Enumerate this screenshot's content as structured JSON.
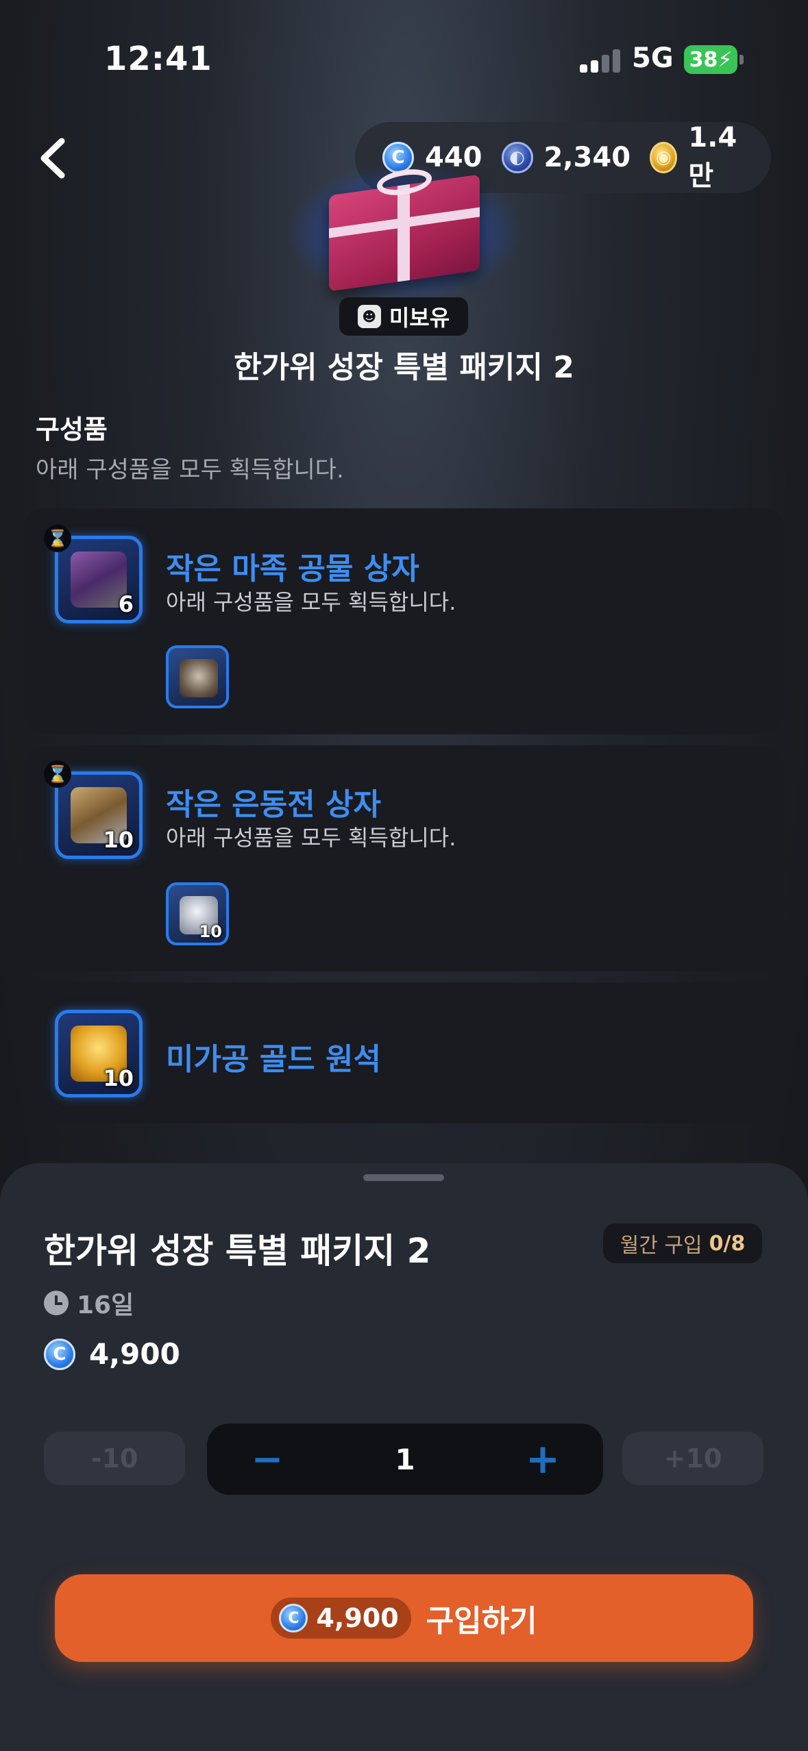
{
  "status_bar": {
    "time": "12:41",
    "network": "5G",
    "battery": "38"
  },
  "header": {
    "currencies": [
      {
        "icon": "blue-gem-coin-icon",
        "value": "440"
      },
      {
        "icon": "dark-blue-coin-icon",
        "value": "2,340"
      },
      {
        "icon": "gold-coin-icon",
        "value": "1.4만"
      }
    ]
  },
  "package": {
    "owned_status": "미보유",
    "title": "한가위 성장 특별 패키지 2"
  },
  "contents": {
    "title": "구성품",
    "subtitle": "아래 구성품을 모두 획득합니다.",
    "items": [
      {
        "name": "작은 마족 공물 상자",
        "desc": "아래 구성품을 모두 획득합니다.",
        "qty": "6",
        "sub_qty": "",
        "timed": true
      },
      {
        "name": "작은 은동전 상자",
        "desc": "아래 구성품을 모두 획득합니다.",
        "qty": "10",
        "sub_qty": "10",
        "timed": true
      },
      {
        "name": "미가공 골드 원석",
        "desc": "",
        "qty": "10",
        "sub_qty": "",
        "timed": false
      }
    ]
  },
  "sheet": {
    "title": "한가위 성장 특별 패키지 2",
    "limit_label": "월간 구입",
    "limit_value": "0/8",
    "duration": "16일",
    "price": "4,900",
    "qty_minus10": "-10",
    "qty_plus10": "+10",
    "qty_minus": "−",
    "qty_plus": "+",
    "quantity": "1",
    "buy_price": "4,900",
    "buy_label": "구입하기"
  },
  "colors": {
    "accent_blue": "#3d8ef0",
    "buy_orange": "#e3602b",
    "limit_gold": "#f0c48c"
  }
}
